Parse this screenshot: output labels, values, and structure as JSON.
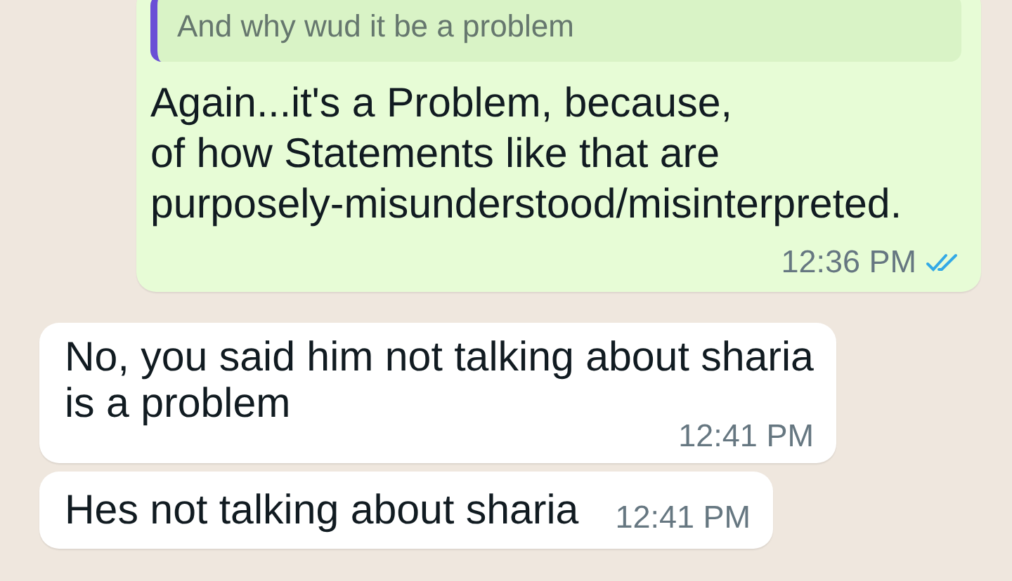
{
  "messages": [
    {
      "kind": "outgoing",
      "quote": "And why wud it be a problem",
      "text": "Again...it's a Problem, because,\nof how Statements like that are\npurposely-misunderstood/misinterpreted.",
      "time": "12:36 PM",
      "read": true
    },
    {
      "kind": "incoming",
      "text": "No, you said him not talking about sharia\nis a problem",
      "time": "12:41 PM"
    },
    {
      "kind": "short",
      "text": "Hes not talking about sharia",
      "time": "12:41 PM"
    }
  ]
}
